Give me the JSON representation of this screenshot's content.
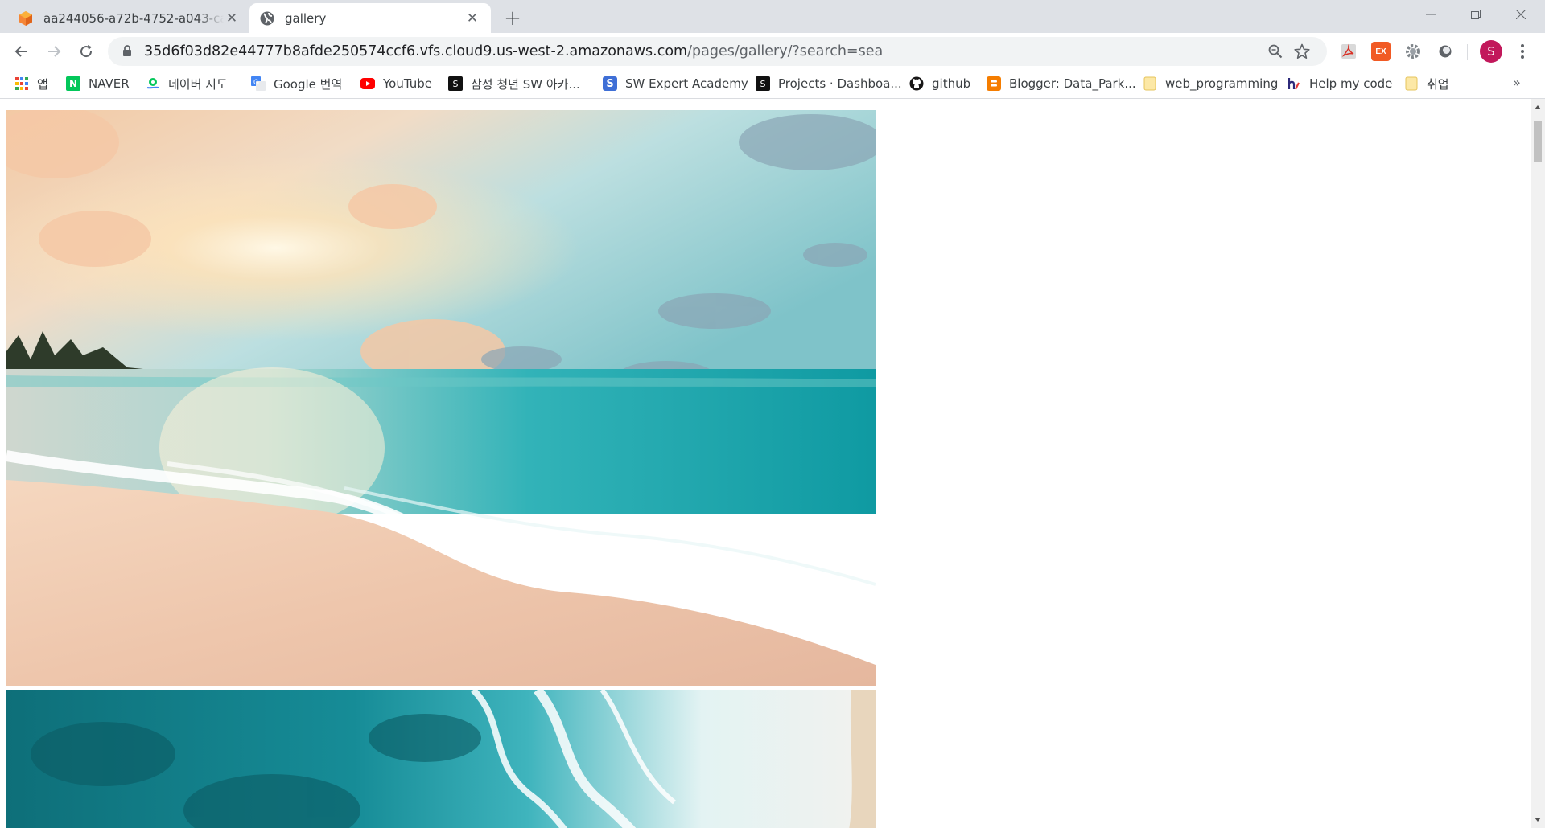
{
  "tabs": [
    {
      "title": "aa244056-a72b-4752-a043-ca41",
      "icon": "cloud9-cube-icon",
      "active": false
    },
    {
      "title": "gallery",
      "icon": "globe-icon",
      "active": true
    }
  ],
  "new_tab_label": "+",
  "address_bar": {
    "host": "35d6f03d82e44777b8afde250574ccf6.vfs.cloud9.us-west-2.amazonaws.com",
    "path": "/pages/gallery/?search=sea"
  },
  "profile": {
    "initial": "S",
    "color": "#c2185b"
  },
  "bookmarks": [
    {
      "label": "앱",
      "icon": "apps-grid-icon"
    },
    {
      "label": "NAVER",
      "icon": "naver-icon"
    },
    {
      "label": "네이버 지도",
      "icon": "naver-map-icon"
    },
    {
      "label": "Google 번역",
      "icon": "google-translate-icon"
    },
    {
      "label": "YouTube",
      "icon": "youtube-icon"
    },
    {
      "label": "삼성 청년 SW 아카...",
      "icon": "ssafy-icon"
    },
    {
      "label": "SW Expert Academy",
      "icon": "swea-icon"
    },
    {
      "label": "Projects · Dashboa...",
      "icon": "gitlab-icon"
    },
    {
      "label": "github",
      "icon": "github-icon"
    },
    {
      "label": "Blogger: Data_Park...",
      "icon": "blogger-icon"
    },
    {
      "label": "web_programming",
      "icon": "folder-icon"
    },
    {
      "label": "Help my code",
      "icon": "help-my-code-icon"
    },
    {
      "label": "취업",
      "icon": "folder-icon"
    }
  ],
  "bookmarks_overflow": "»",
  "gallery": {
    "images": [
      {
        "subject": "beach-sunset"
      },
      {
        "subject": "aerial-ocean-waves"
      }
    ]
  }
}
